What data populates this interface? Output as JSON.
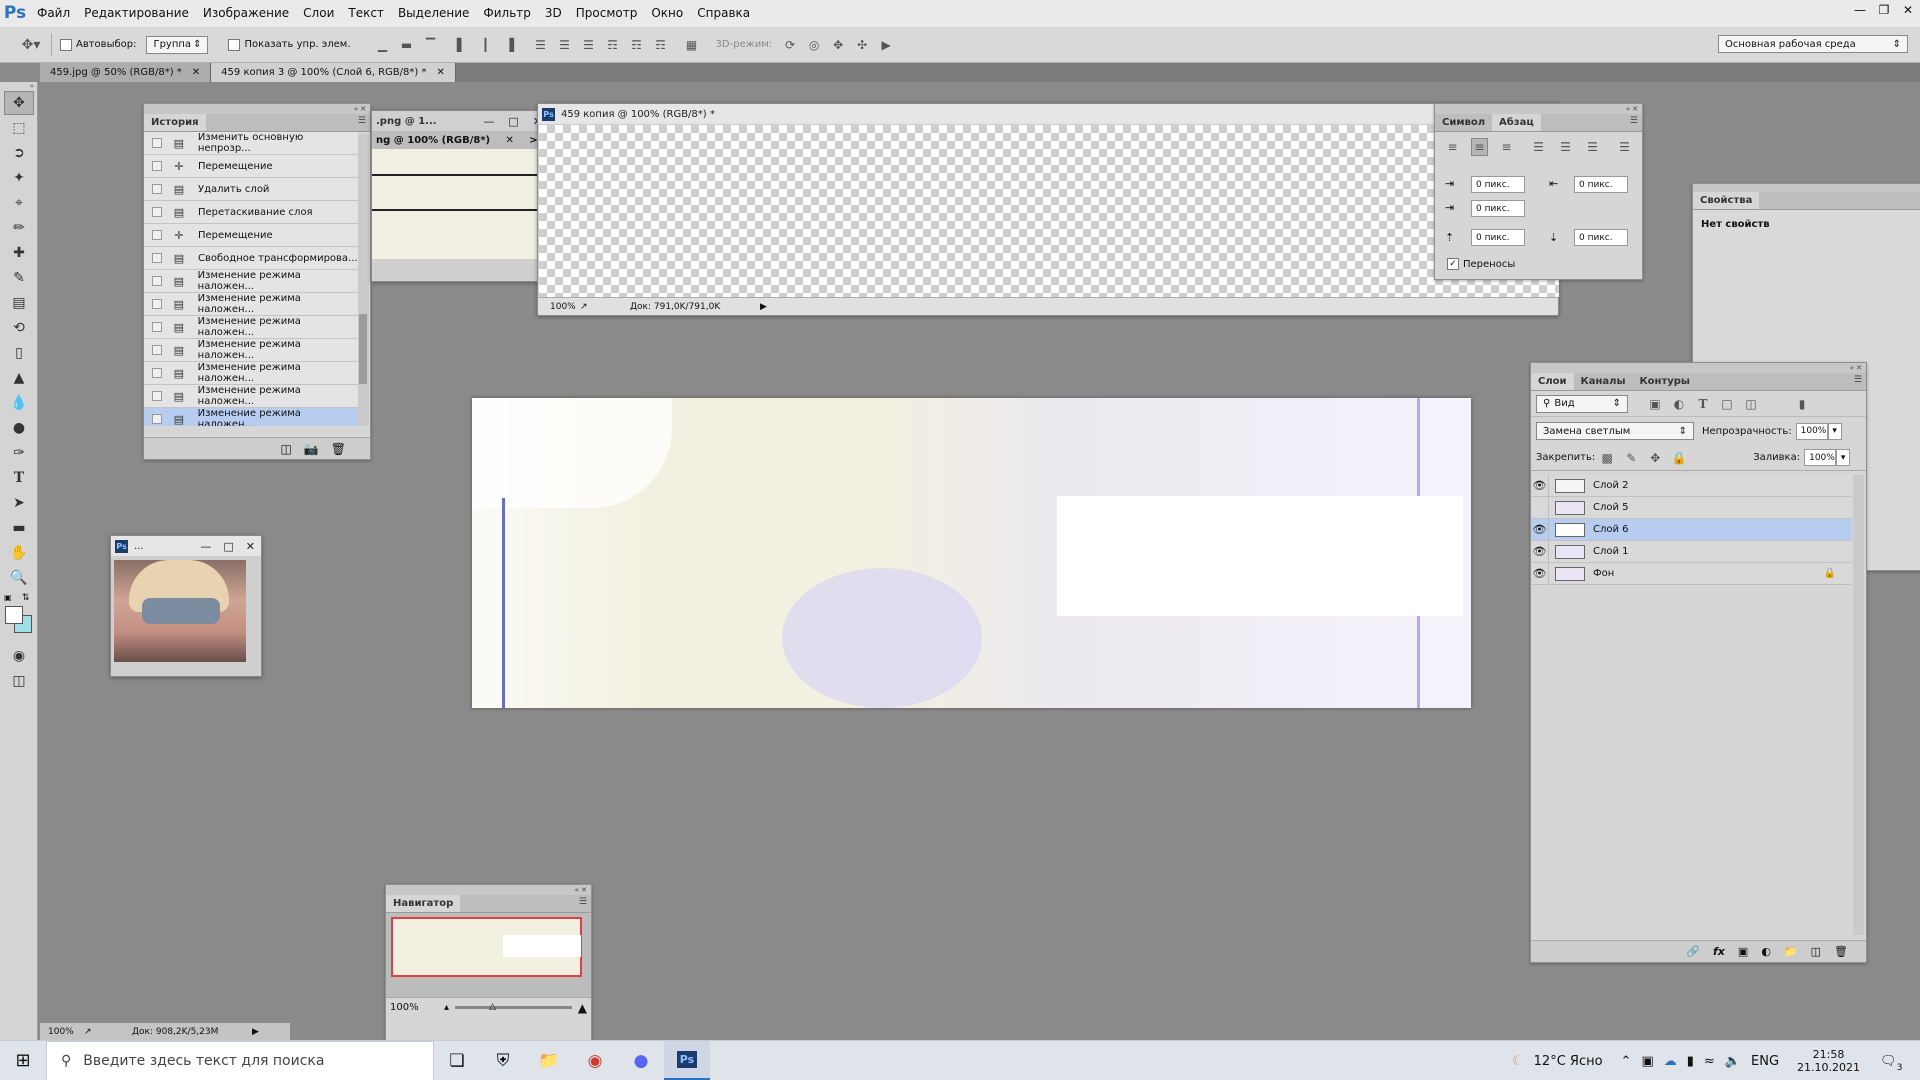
{
  "app": {
    "logo": "Ps"
  },
  "menu": [
    "Файл",
    "Редактирование",
    "Изображение",
    "Слои",
    "Текст",
    "Выделение",
    "Фильтр",
    "3D",
    "Просмотр",
    "Окно",
    "Справка"
  ],
  "options": {
    "autoselect_label": "Автовыбор:",
    "autoselect_value": "Группа",
    "show_transform": "Показать упр. элем.",
    "mode_3d": "3D-режим:",
    "workspace": "Основная рабочая среда"
  },
  "doc_tabs": [
    {
      "label": "459.jpg @ 50% (RGB/8*) *"
    },
    {
      "label": "459 копия 3 @ 100% (Слой 6, RGB/8*) *"
    }
  ],
  "history": {
    "tab": "История",
    "items": [
      {
        "icon": "document-icon",
        "label": "Изменить основную непрозр..."
      },
      {
        "icon": "move-icon",
        "label": "Перемещение"
      },
      {
        "icon": "document-icon",
        "label": "Удалить слой"
      },
      {
        "icon": "document-icon",
        "label": "Перетаскивание слоя"
      },
      {
        "icon": "move-icon",
        "label": "Перемещение"
      },
      {
        "icon": "document-icon",
        "label": "Свободное трансформирова..."
      },
      {
        "icon": "document-icon",
        "label": "Изменение режима наложен..."
      },
      {
        "icon": "document-icon",
        "label": "Изменение режима наложен..."
      },
      {
        "icon": "document-icon",
        "label": "Изменение режима наложен..."
      },
      {
        "icon": "document-icon",
        "label": "Изменение режима наложен..."
      },
      {
        "icon": "document-icon",
        "label": "Изменение режима наложен..."
      },
      {
        "icon": "document-icon",
        "label": "Изменение режима наложен..."
      },
      {
        "icon": "document-icon",
        "label": "Изменение режима наложен..."
      }
    ],
    "selected_index": 12
  },
  "png_window": {
    "title": ".png @ 1...",
    "tab": "ng @ 100% (RGB/8*)",
    "more": ">>"
  },
  "doc_window": {
    "title": "459 копия @ 100% (RGB/8*) *",
    "zoom": "100%",
    "doc_size": "Док: 791,0K/791,0K"
  },
  "paragraph": {
    "tabs": [
      "Символ",
      "Абзац"
    ],
    "fields": [
      "0 пикс.",
      "0 пикс.",
      "0 пикс.",
      "0 пикс.",
      "0 пикс."
    ],
    "hyphenation": "Переносы"
  },
  "properties": {
    "tab": "Свойства",
    "text": "Нет свойств"
  },
  "small_window": {
    "title": "..."
  },
  "layers": {
    "tabs": [
      "Слои",
      "Каналы",
      "Контуры"
    ],
    "filter": "Вид",
    "blend_mode": "Замена светлым",
    "opacity_label": "Непрозрачность:",
    "opacity": "100%",
    "lock_label": "Закрепить:",
    "fill_label": "Заливка:",
    "fill": "100%",
    "items": [
      {
        "name": "Слой 2",
        "visible": true
      },
      {
        "name": "Слой 5",
        "visible": false
      },
      {
        "name": "Слой 6",
        "visible": true,
        "selected": true
      },
      {
        "name": "Слой 1",
        "visible": true
      },
      {
        "name": "Фон",
        "visible": true,
        "locked": true
      }
    ]
  },
  "navigator": {
    "tab": "Навигатор",
    "zoom": "100%"
  },
  "main_status": {
    "zoom": "100%",
    "doc_size": "Док: 908,2K/5,23M"
  },
  "taskbar": {
    "search_placeholder": "Введите здесь текст для поиска",
    "weather": "12°C Ясно",
    "lang": "ENG",
    "time": "21:58",
    "date": "21.10.2021",
    "notifications": "3"
  },
  "colors": {
    "accent_blue": "#b7cdf0",
    "ps_blue": "#2a73c2",
    "canvas_bg": "#8a8a8a"
  }
}
